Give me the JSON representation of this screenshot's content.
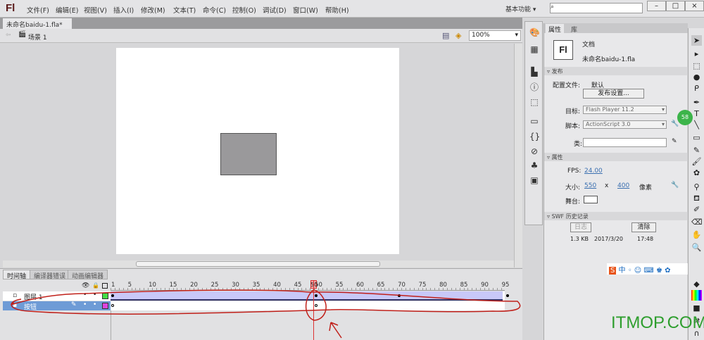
{
  "app": {
    "logo": "Fl",
    "menu": [
      "文件(F)",
      "编辑(E)",
      "视图(V)",
      "插入(I)",
      "修改(M)",
      "文本(T)",
      "命令(C)",
      "控制(O)",
      "调试(D)",
      "窗口(W)",
      "帮助(H)"
    ],
    "workspace": "基本功能",
    "window_buttons": [
      "–",
      "□",
      "×"
    ]
  },
  "document": {
    "tab": "未命名baidu-1.fla*",
    "close": "×",
    "scene": "场景 1",
    "zoom": "100%"
  },
  "stage": {
    "color": "#ffffff",
    "shape_color": "#9a999b"
  },
  "timeline": {
    "tabs": [
      "时间轴",
      "编译器错误",
      "动画编辑器"
    ],
    "ticks": [
      "1",
      "5",
      "10",
      "15",
      "20",
      "25",
      "30",
      "35",
      "40",
      "45",
      "50",
      "55",
      "60",
      "65",
      "70",
      "75",
      "80",
      "85",
      "90",
      "95"
    ],
    "current_frame": 50,
    "layers": [
      {
        "name": "图层 1",
        "color": "#44dd44"
      },
      {
        "name": "按钮",
        "color": "#dd44dd",
        "selected": true
      }
    ]
  },
  "properties": {
    "tabs": [
      "属性",
      "库"
    ],
    "doc_type": "文档",
    "doc_name": "未命名baidu-1.fla",
    "doc_icon": "Fl",
    "publish_section": "发布",
    "profile_label": "配置文件:",
    "profile_value": "默认",
    "publish_settings": "发布设置...",
    "target_label": "目标:",
    "target_value": "Flash Player 11.2",
    "script_label": "脚本:",
    "script_value": "ActionScript 3.0",
    "class_label": "类:",
    "props_section": "属性",
    "fps_label": "FPS:",
    "fps": "24.00",
    "size_label": "大小:",
    "width": "550",
    "x": "x",
    "height": "400",
    "unit": "像素",
    "stage_label": "舞台:",
    "swf_section": "SWF 历史记录",
    "log": "日志",
    "clear": "清除",
    "swf_size": "1.3 KB",
    "swf_date": "2017/3/20",
    "swf_time": "17:48"
  },
  "overlay": {
    "ime": "中 ◦ ☺ ⌨ ♚ ✿",
    "badge": "58",
    "watermark": "ITMOP.COM"
  }
}
